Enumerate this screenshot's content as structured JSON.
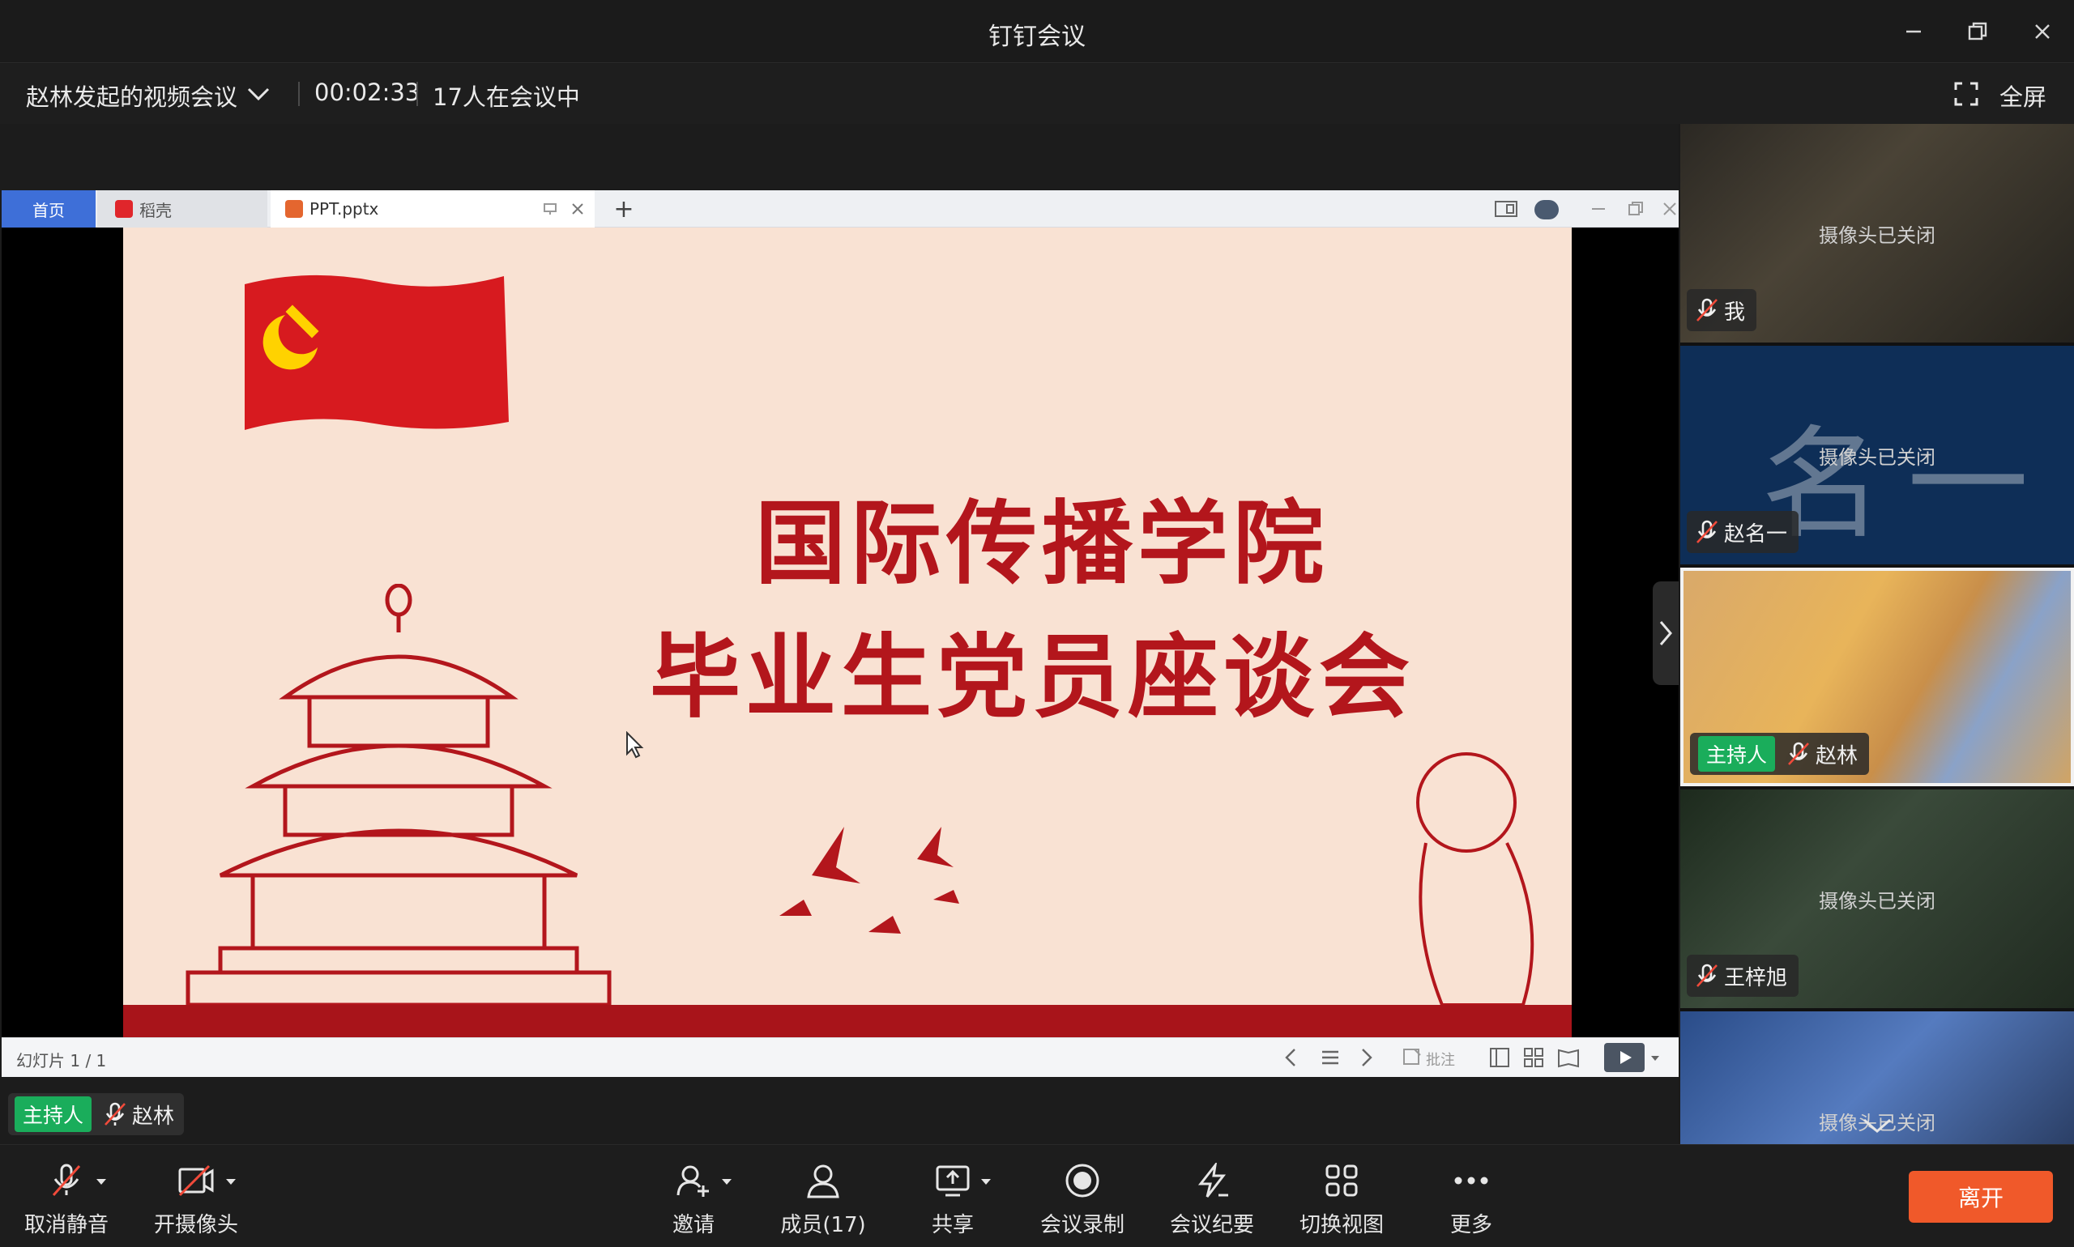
{
  "app": {
    "window_title": "钉钉会议"
  },
  "infobar": {
    "meeting_title": "赵林发起的视频会议",
    "timer": "00:02:33",
    "participant_count": "17人在会议中",
    "fullscreen_label": "全屏"
  },
  "shared_window": {
    "tabs": [
      {
        "label": "首页"
      },
      {
        "label": "稻壳"
      },
      {
        "label": "PPT.pptx"
      }
    ],
    "slide_title_line1": "国际传播学院",
    "slide_title_line2": "毕业生党员座谈会",
    "slide_number": "幻灯片 1 / 1",
    "annotate_label": "批注"
  },
  "presenter": {
    "role_badge": "主持人",
    "name": "赵林"
  },
  "participants": [
    {
      "name": "我",
      "status": "摄像头已关闭",
      "host": false
    },
    {
      "name": "赵名一",
      "status": "摄像头已关闭",
      "host": false,
      "avatar_text": "名一"
    },
    {
      "name": "赵林",
      "status": "",
      "host": true,
      "role_badge": "主持人"
    },
    {
      "name": "王梓旭",
      "status": "摄像头已关闭",
      "host": false
    },
    {
      "name": "",
      "status": "摄像头已关闭",
      "host": false
    }
  ],
  "toolbar": {
    "unmute": "取消静音",
    "camera": "开摄像头",
    "invite": "邀请",
    "members": "成员(17)",
    "share": "共享",
    "record": "会议录制",
    "minutes": "会议纪要",
    "switch_view": "切换视图",
    "more": "更多",
    "leave": "离开"
  },
  "colors": {
    "host_badge": "#1aad5b",
    "leave_button": "#f0592a",
    "slide_red": "#b3161c",
    "slide_background": "#f9e2d3",
    "home_tab": "#3e6fd8"
  }
}
